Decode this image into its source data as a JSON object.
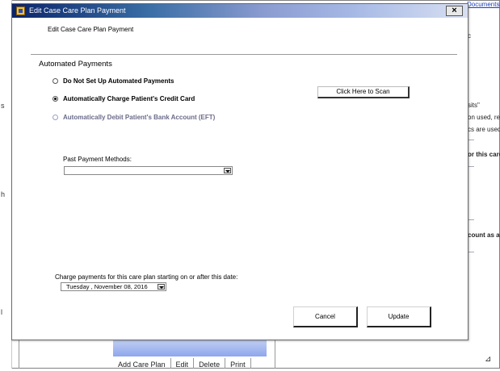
{
  "background": {
    "link": "Documents",
    "right_texts": [
      "c",
      "sits\"",
      "on used, rega",
      "cs are used.",
      "or this care",
      "count as a"
    ],
    "left_texts": [
      "s",
      "h",
      "l"
    ],
    "tabs": [
      "Add Care Plan",
      "Edit",
      "Delete",
      "Print"
    ]
  },
  "dialog": {
    "title": "Edit Case Care Plan Payment",
    "close_label": "×",
    "header": "Edit Case Care Plan Payment",
    "section_title": "Automated Payments",
    "options": [
      {
        "label": "Do Not Set Up Automated Payments",
        "checked": false,
        "disabled": false
      },
      {
        "label": "Automatically Charge Patient's Credit Card",
        "checked": true,
        "disabled": false
      },
      {
        "label": "Automatically Debit Patient's Bank Account (EFT)",
        "checked": false,
        "disabled": true
      }
    ],
    "scan_label": "Click Here to Scan",
    "past_methods_label": "Past Payment Methods:",
    "past_methods_value": "",
    "start_date_label": "Charge payments for this care plan starting on or after this date:",
    "start_date_value": "Tuesday   , November 08, 2016",
    "cancel_label": "Cancel",
    "update_label": "Update"
  }
}
